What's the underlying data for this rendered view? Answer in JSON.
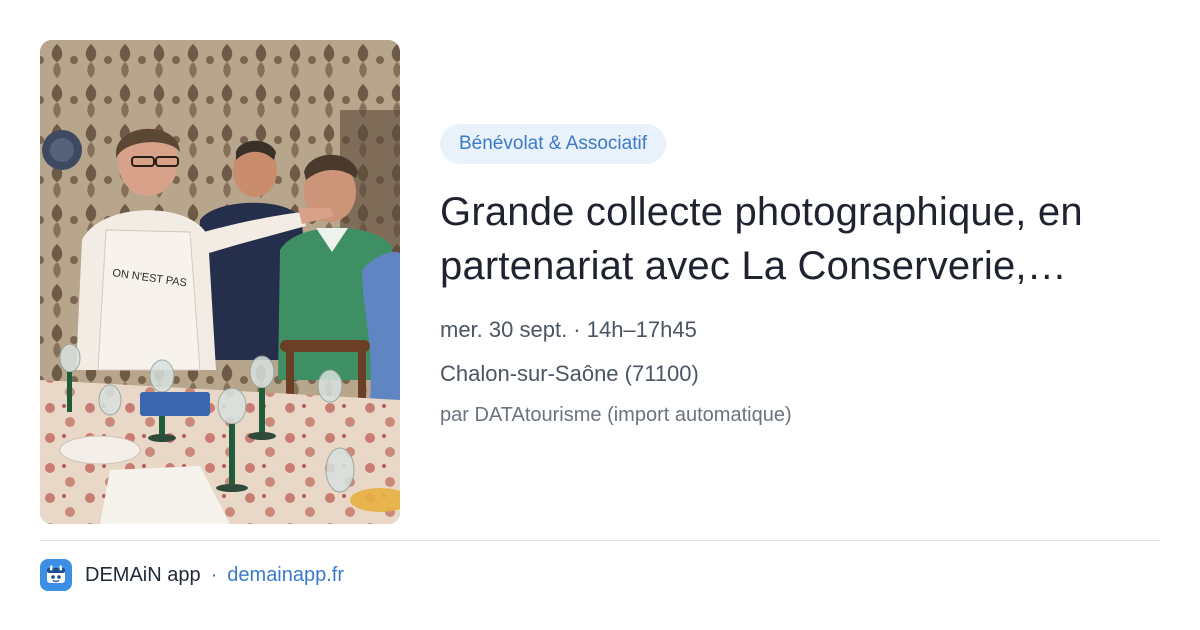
{
  "event": {
    "image_alt": "Photographie d'archive : un groupe de personnes autour d'une table de fête",
    "category": "Bénévolat & Associatif",
    "title": "Grande collecte photographique, en partenariat avec La Conserverie, espace d'archives et de création",
    "date_time": "mer. 30 sept. · 14h–17h45",
    "location": "Chalon-sur-Saône (71100)",
    "source": "par DATAtourisme (import automatique)"
  },
  "footer": {
    "app_icon": "demain-app-icon",
    "app_name": "DEMAiN app",
    "separator": "·",
    "domain": "demainapp.fr"
  },
  "colors": {
    "accent": "#3a7ac9",
    "tag_bg": "#e9f1fb",
    "app_icon_bg": "#3d8fe6"
  }
}
